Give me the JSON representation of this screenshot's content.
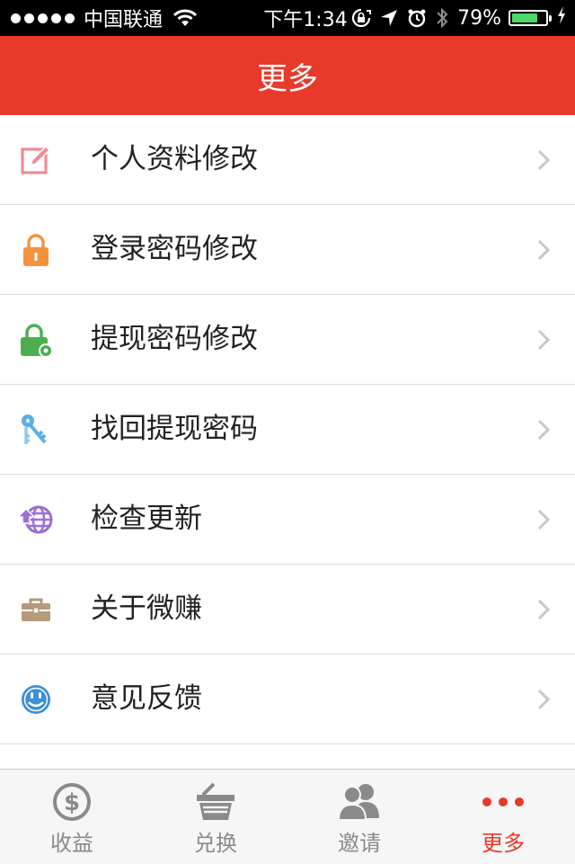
{
  "status_bar": {
    "carrier": "中国联通",
    "time": "下午1:34",
    "battery": "79%",
    "battery_level": 0.79,
    "icons": [
      "signal-dots",
      "wifi-icon",
      "rotation-lock-icon",
      "location-icon",
      "alarm-icon",
      "bluetooth-icon",
      "battery-icon",
      "charging-icon"
    ]
  },
  "nav": {
    "title": "更多"
  },
  "menu": {
    "items": [
      {
        "label": "个人资料修改",
        "icon": "edit-icon",
        "color": "#f08b96"
      },
      {
        "label": "登录密码修改",
        "icon": "lock-icon",
        "color": "#f5923e"
      },
      {
        "label": "提现密码修改",
        "icon": "lock-gear-icon",
        "color": "#4cae4f"
      },
      {
        "label": "找回提现密码",
        "icon": "keys-icon",
        "color": "#5aaee6"
      },
      {
        "label": "检查更新",
        "icon": "globe-update-icon",
        "color": "#9b6fd6"
      },
      {
        "label": "关于微赚",
        "icon": "briefcase-icon",
        "color": "#b59a7c"
      },
      {
        "label": "意见反馈",
        "icon": "smiley-icon",
        "color": "#3d8fd6"
      }
    ]
  },
  "tabbar": {
    "active": "更多",
    "tabs": [
      {
        "label": "收益",
        "icon": "dollar-coin-icon"
      },
      {
        "label": "兑换",
        "icon": "basket-icon"
      },
      {
        "label": "邀请",
        "icon": "users-icon"
      },
      {
        "label": "更多",
        "icon": "more-dots-icon"
      }
    ]
  },
  "colors": {
    "accent": "#e8392a",
    "inactive": "#8a8a8a"
  }
}
